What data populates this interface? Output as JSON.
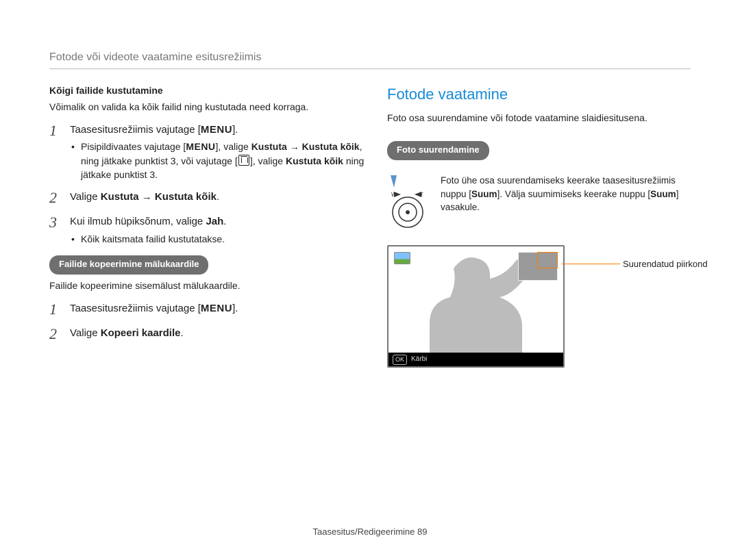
{
  "header": {
    "title": "Fotode või videote vaatamine esitusrežiimis"
  },
  "left": {
    "delete_all_head": "Kõigi failide kustutamine",
    "delete_all_desc": "Võimalik on valida ka kõik failid ning kustutada need korraga.",
    "menu_word": "MENU",
    "step1_a": "Taasesitusrežiimis vajutage [",
    "step1_b": "].",
    "step1_bullet_a": "Pisipildivaates vajutage [",
    "step1_bullet_b": "], valige ",
    "step1_bullet_c": "Kustuta → Kustuta kõik",
    "step1_bullet_d": ", ning jätkake punktist 3, või vajutage [",
    "step1_bullet_e": "], valige ",
    "step1_bullet_f": "Kustuta kõik",
    "step1_bullet_g": " ning jätkake punktist 3.",
    "step2_a": "Valige ",
    "step2_b": "Kustuta → Kustuta kõik",
    "step2_c": ".",
    "step3_a": "Kui ilmub hüpiksõnum, valige ",
    "step3_b": "Jah",
    "step3_c": ".",
    "step3_bullet": "Kõik kaitsmata failid kustutatakse.",
    "copy_head": "Failide kopeerimine mälukaardile",
    "copy_desc": "Failide kopeerimine sisemälust mälukaardile.",
    "copy_step1_a": "Taasesitusrežiimis vajutage [",
    "copy_step1_b": "].",
    "copy_step2_a": "Valige ",
    "copy_step2_b": "Kopeeri kaardile",
    "copy_step2_c": "."
  },
  "right": {
    "title": "Fotode vaatamine",
    "intro": "Foto osa suurendamine või fotode vaatamine slaidiesitusena.",
    "zoom_head": "Foto suurendamine",
    "zoom_text_a": "Foto ühe osa suurendamiseks keerake taasesitusrežiimis nuppu [",
    "zoom_text_b": "Suum",
    "zoom_text_c": "]. Välja suumimiseks keerake nuppu [",
    "zoom_text_d": "Suum",
    "zoom_text_e": "] vasakule.",
    "annot": "Suurendatud piirkond",
    "footer_ok": "OK",
    "footer_label": "Kärbi"
  },
  "footer": {
    "text": "Taasesitus/Redigeerimine  89"
  }
}
